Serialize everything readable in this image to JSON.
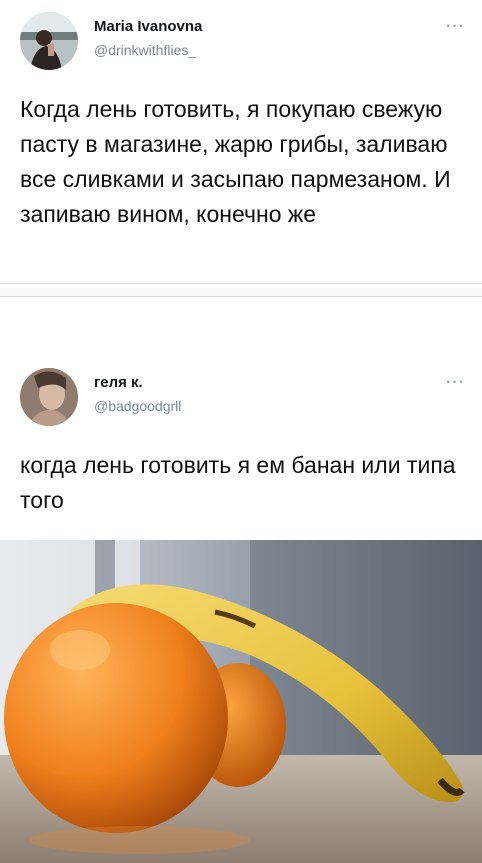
{
  "tweets": [
    {
      "name": "Maria Ivanovna",
      "handle": "@drinkwithflies_",
      "more": "···",
      "text": "Когда лень готовить, я покупаю свежую пасту в магазине, жарю грибы, заливаю все сливками и засыпаю пармезаном. И запиваю вином, конечно же"
    },
    {
      "name": "геля к.",
      "handle": "@badgoodgrll",
      "more": "···",
      "text": "когда лень готовить я ем банан или типа того"
    }
  ],
  "icons": {
    "more": "more-options-icon",
    "avatar": "avatar"
  },
  "colors": {
    "handle": "#7a8793",
    "divider": "#d9d9d9",
    "banana": "#e8c23c",
    "orange": "#f07f1c"
  }
}
